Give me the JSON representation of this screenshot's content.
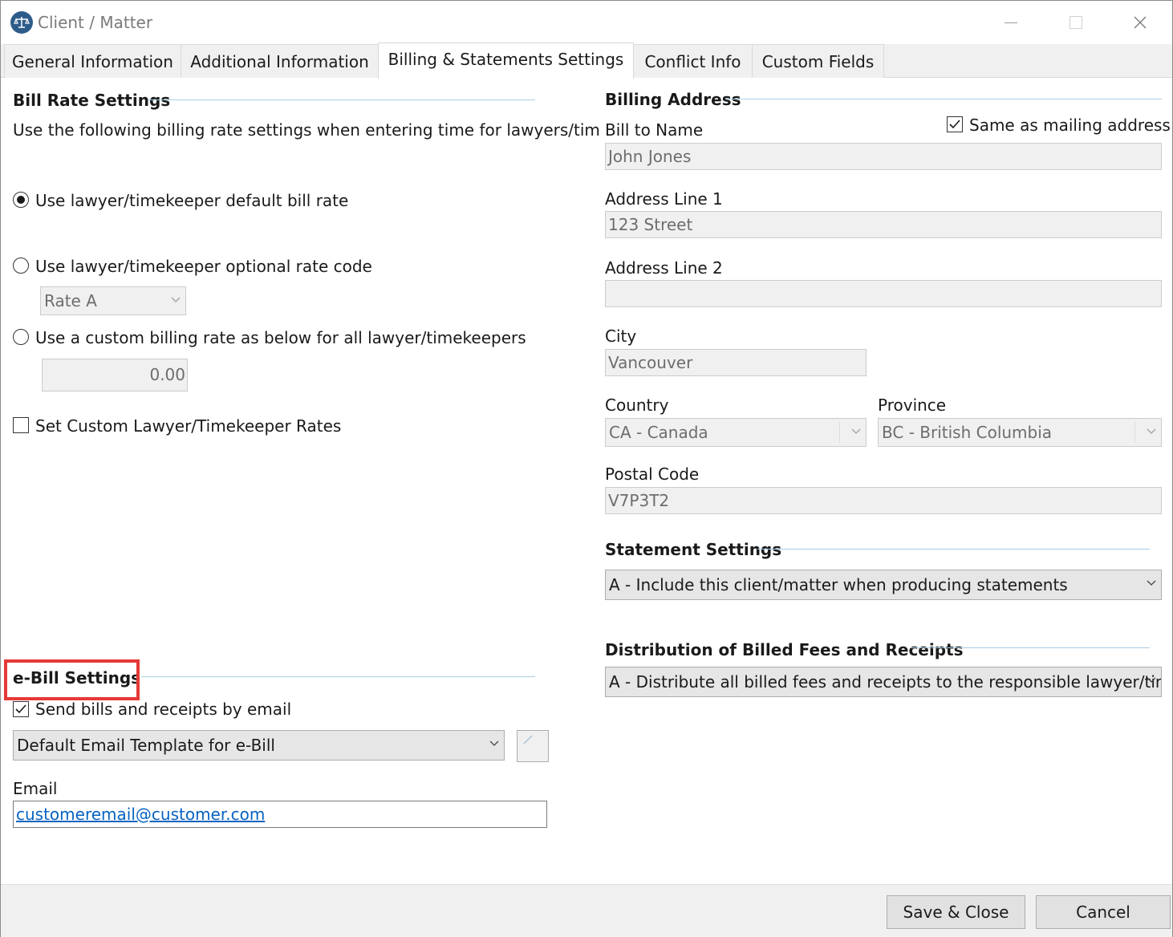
{
  "window": {
    "title": "Client / Matter"
  },
  "tabs": [
    {
      "label": "General Information"
    },
    {
      "label": "Additional Information"
    },
    {
      "label": "Billing & Statements Settings"
    },
    {
      "label": "Conflict Info"
    },
    {
      "label": "Custom Fields"
    }
  ],
  "active_tab": "Billing & Statements Settings",
  "bill_rate": {
    "title": "Bill Rate Settings",
    "description": "Use the following billing rate settings when entering time for lawyers/tim",
    "option_default": "Use lawyer/timekeeper default bill rate",
    "option_code": "Use lawyer/timekeeper optional rate code",
    "rate_code_value": "Rate A",
    "option_custom": "Use a custom billing rate as below for all lawyer/timekeepers",
    "custom_rate_value": "0.00",
    "custom_rates_label": "Set Custom Lawyer/Timekeeper Rates"
  },
  "ebill": {
    "title": "e-Bill Settings",
    "send_email_label": "Send bills and receipts by email",
    "template_value": "Default Email Template for e-Bill",
    "email_label": "Email",
    "email_value": "customeremail@customer.com"
  },
  "billing_address": {
    "title": "Billing Address",
    "same_as_mailing_label": "Same as mailing address",
    "bill_to_label": "Bill to Name",
    "bill_to_value": "John Jones",
    "address1_label": "Address Line 1",
    "address1_value": "123 Street",
    "address2_label": "Address Line 2",
    "address2_value": "",
    "city_label": "City",
    "city_value": "Vancouver",
    "country_label": "Country",
    "country_value": "CA - Canada",
    "province_label": "Province",
    "province_value": "BC - British Columbia",
    "postal_label": "Postal Code",
    "postal_value": "V7P3T2"
  },
  "statement": {
    "title": "Statement Settings",
    "value": "A - Include this client/matter when producing statements"
  },
  "distribution": {
    "title": "Distribution of Billed Fees and Receipts",
    "value": "A - Distribute all billed fees and receipts to the responsible lawyer/time"
  },
  "footer": {
    "save_label": "Save & Close",
    "cancel_label": "Cancel"
  },
  "colors": {
    "highlight": "#e53935",
    "section_line": "#a9cde5",
    "link": "#0563c1"
  }
}
